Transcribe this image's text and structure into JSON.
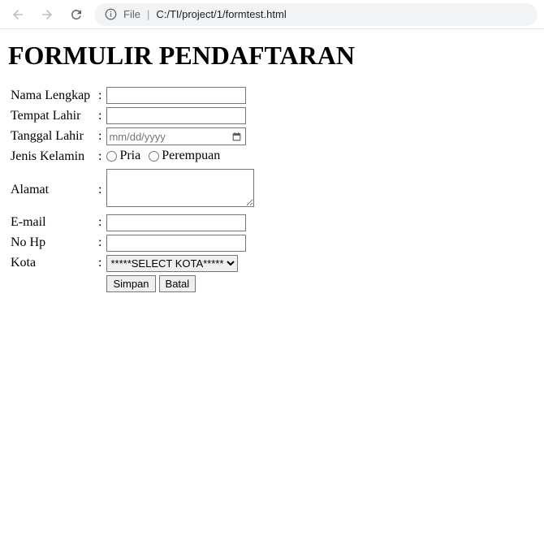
{
  "browser": {
    "url_prefix": "File",
    "url_path": "C:/TI/project/1/formtest.html"
  },
  "page": {
    "title": "FORMULIR PENDAFTARAN"
  },
  "form": {
    "nama_label": "Nama Lengkap",
    "tempat_label": "Tempat Lahir",
    "tanggal_label": "Tanggal Lahir",
    "tanggal_placeholder": "mm/dd/yyyy",
    "jenis_label": "Jenis Kelamin",
    "jenis_pria": "Pria",
    "jenis_perempuan": "Perempuan",
    "alamat_label": "Alamat",
    "email_label": "E-mail",
    "nohp_label": "No Hp",
    "kota_label": "Kota",
    "kota_selected": "*****SELECT KOTA*****",
    "colon": ":",
    "simpan": "Simpan",
    "batal": "Batal"
  }
}
